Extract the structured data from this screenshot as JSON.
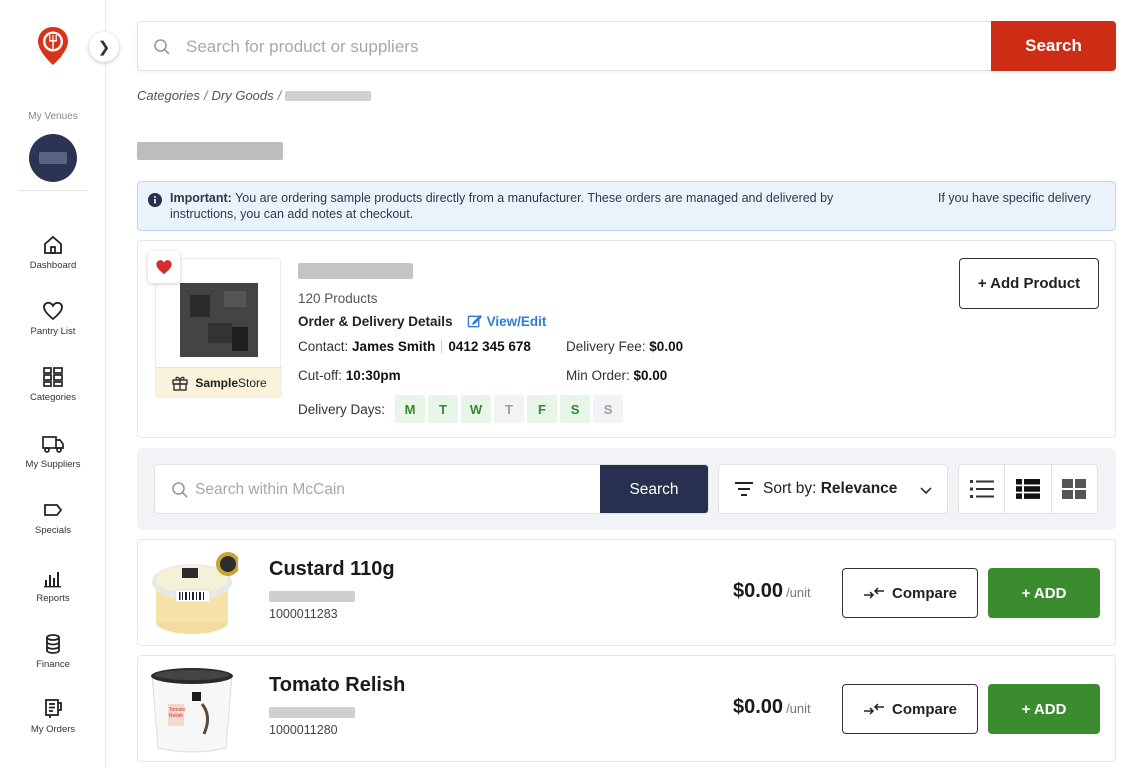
{
  "sidebar": {
    "venues_label": "My Venues",
    "items": [
      {
        "label": "Dashboard"
      },
      {
        "label": "Pantry List"
      },
      {
        "label": "Categories"
      },
      {
        "label": "My Suppliers"
      },
      {
        "label": "Specials"
      },
      {
        "label": "Reports"
      },
      {
        "label": "Finance"
      },
      {
        "label": "My Orders"
      }
    ]
  },
  "search": {
    "placeholder": "Search for product or suppliers",
    "button_label": "Search"
  },
  "breadcrumb": {
    "root": "Categories",
    "level1": "Dry Goods"
  },
  "alert": {
    "title": "Important:",
    "message": "You are ordering sample products directly from a manufacturer. These orders are managed and delivered by",
    "message_line2": "instructions, you can add notes at checkout.",
    "message_right": "If you have specific delivery"
  },
  "supplier": {
    "badge": {
      "bold": "Sample",
      "rest": "Store"
    },
    "product_count": "120 Products",
    "details_title": "Order & Delivery Details",
    "view_edit_label": "View/Edit",
    "contact_label": "Contact:",
    "contact_name": "James Smith",
    "contact_phone": "0412 345 678",
    "delivery_fee_label": "Delivery Fee:",
    "delivery_fee": "$0.00",
    "cutoff_label": "Cut-off:",
    "cutoff": "10:30pm",
    "min_order_label": "Min Order:",
    "min_order": "$0.00",
    "delivery_days_label": "Delivery Days:",
    "days": [
      {
        "d": "M",
        "active": true
      },
      {
        "d": "T",
        "active": true
      },
      {
        "d": "W",
        "active": true
      },
      {
        "d": "T",
        "active": false
      },
      {
        "d": "F",
        "active": true
      },
      {
        "d": "S",
        "active": true
      },
      {
        "d": "S",
        "active": false
      }
    ],
    "add_product_label": "+ Add Product"
  },
  "toolbar": {
    "search_placeholder": "Search within McCain",
    "search_button": "Search",
    "sort_label": "Sort by:",
    "sort_value": "Relevance"
  },
  "products": [
    {
      "name": "Custard 110g",
      "code": "1000011283",
      "price": "$0.00",
      "unit": "/unit",
      "compare_label": "Compare",
      "add_label": "+ ADD"
    },
    {
      "name": "Tomato Relish",
      "code": "1000011280",
      "price": "$0.00",
      "unit": "/unit",
      "compare_label": "Compare",
      "add_label": "+ ADD"
    }
  ],
  "colors": {
    "brand_red": "#cc2d14",
    "navy": "#27304e",
    "green": "#3b8c2f",
    "link_blue": "#2e7bd6",
    "alert_bg": "#eaf3fc"
  }
}
